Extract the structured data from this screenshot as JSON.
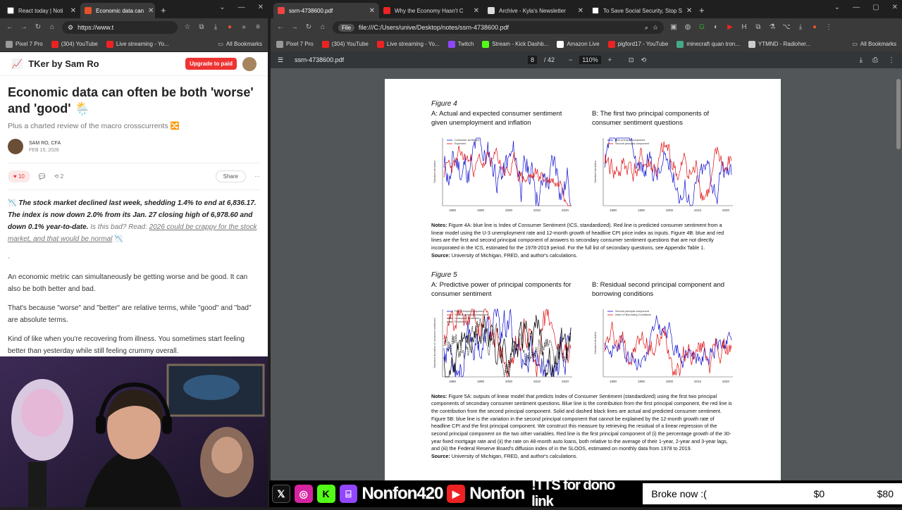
{
  "left_browser": {
    "tabs": [
      {
        "label": "React today | Noti"
      },
      {
        "label": "Economic data can"
      }
    ],
    "url": "https://www.t",
    "bookmarks": [
      "Pixel 7 Pro",
      "(304) YouTube",
      "Live streaming - Yo..."
    ],
    "bookmarks_all": "All Bookmarks"
  },
  "article": {
    "brand": "TKer by Sam Ro",
    "upgrade_label": "Upgrade to paid",
    "title": "Economic data can often be both 'worse' and 'good' 🌦️",
    "subtitle": "Plus a charted review of the macro crosscurrents 🔀",
    "author": "SAM RO, CFA",
    "date": "FEB 15, 2026",
    "likes": "10",
    "restacks": "2",
    "share_label": "Share",
    "p1_bold": "The stock market declined last week, shedding 1.4% to end at 6,836.17. The index is now down 2.0% from its Jan. 27 closing high of 6,978.60 and down 0.1% year-to-date.",
    "p1_q": " Is this bad? Read: ",
    "p1_link": "2026 could be crappy for the stock market, and that would be normal",
    "separator": "-",
    "p2": "An economic metric can simultaneously be getting worse and be good. It can also be both better and bad.",
    "p3": "That's because \"worse\" and \"better\" are relative terms, while \"good\" and \"bad\" are absolute terms.",
    "p4": "Kind of like when you're recovering from illness. You sometimes start feeling better than yesterday while still feeling crummy overall."
  },
  "right_browser": {
    "tabs": [
      {
        "label": "ssrn-4738600.pdf"
      },
      {
        "label": "Why the Economy Hasn't C"
      },
      {
        "label": "Archive - Kyla's Newsletter"
      },
      {
        "label": "To Save Social Security, Stop S"
      }
    ],
    "url_chip": "File",
    "url": "file:///C:/Users/unive/Desktop/notes/ssrn-4738600.pdf",
    "bookmarks": [
      "Pixel 7 Pro",
      "(304) YouTube",
      "Live streaming - Yo...",
      "Twitch",
      "Stream - Kick Dashb...",
      "Amazon Live",
      "pigford17 - YouTube",
      "minecraft quan tron...",
      "YTMND - Radioher..."
    ],
    "bookmarks_all": "All Bookmarks"
  },
  "pdf": {
    "filename": "ssrn-4738600.pdf",
    "page": "8",
    "pages": "/ 42",
    "zoom": "110%",
    "fig4": {
      "title": "Figure 4",
      "a_title": "A: Actual and expected consumer sentiment given unemployment and inflation",
      "b_title": "B: The first two principal components of consumer sentiment questions",
      "notes_label": "Notes:",
      "notes": " Figure 4A: blue line is Index of Consumer Sentiment (ICS, standardized). Red line is predicted consumer sentiment from a linear model using the U-3 unemployment rate and 12-month growth of headline CPI price index as inputs. Figure 4B: blue and red lines are the first and second principal component of answers to secondary consumer sentiment questions that are not directly incorporated in the ICS, estimated for the 1978-2019 period. For the full list of secondary questions, see Appendix Table 1.",
      "source_label": "Source:",
      "source": " University of Michigan, FRED, and author's calculations."
    },
    "fig5": {
      "title": "Figure 5",
      "a_title": "A: Predictive power of principal components for consumer sentiment",
      "b_title": "B: Residual second principal component and borrowing conditions",
      "notes_label": "Notes:",
      "notes": " Figure 5A: outputs of linear model that predicts Index of Consumer Sentiment (standardized) using the first two principal components of secondary consumer sentiment questions. Blue line is the contribution from the first principal component, the red line is the contribution from the second principal component. Solid and dashed black lines are actual and predicted consumer sentiment. Figure 5B: blue line is the variation in the second principal component that cannot be explained by the 12-month growth rate of headline CPI and the first principal component. We construct this measure by retrieving the residual of a linear regression of the second principal component on the two other variables. Red line is the first principal component of (i) the percentage growth of the 30-year fixed mortgage rate and (ii) the rate on 48-month auto loans, both relative to the average of their 1-year, 2-year and 3-year lags, and (iii) the Federal Reserve Board's diffusion index of in the SLOOS, estimated on monthly data from 1978 to 2019.",
      "source_label": "Source:",
      "source": " University of Michigan, FRED, and author's calculations."
    },
    "chart_ticks": [
      "1980",
      "1990",
      "2000",
      "2010",
      "2020"
    ],
    "legends": {
      "c4a": [
        "Consumer sentiment",
        "Expected"
      ],
      "c4b": [
        "First principal component",
        "Second principal component"
      ],
      "c5a": [
        "First principal component",
        "Second principal component",
        "Consumer sentiment",
        "Predicted"
      ],
      "c5b": [
        "Second principal component",
        "Index of Borrowing Conditions"
      ]
    },
    "ylabels": {
      "c4a": "Standard deviation",
      "c4b": "Standard deviation",
      "c5a": "Standard deviation of consumer sentiment",
      "c5b": "Standard deviation"
    }
  },
  "stream": {
    "handle1": "Nonfon420",
    "handle2": "Nonfon",
    "tts": "!TTS for dono link",
    "goal_label": "Broke now :(",
    "goal_current": "$0",
    "goal_target": "$80"
  },
  "colors": {
    "accent": "#e33333",
    "chart_blue": "#1010d0",
    "chart_red": "#e01010"
  }
}
